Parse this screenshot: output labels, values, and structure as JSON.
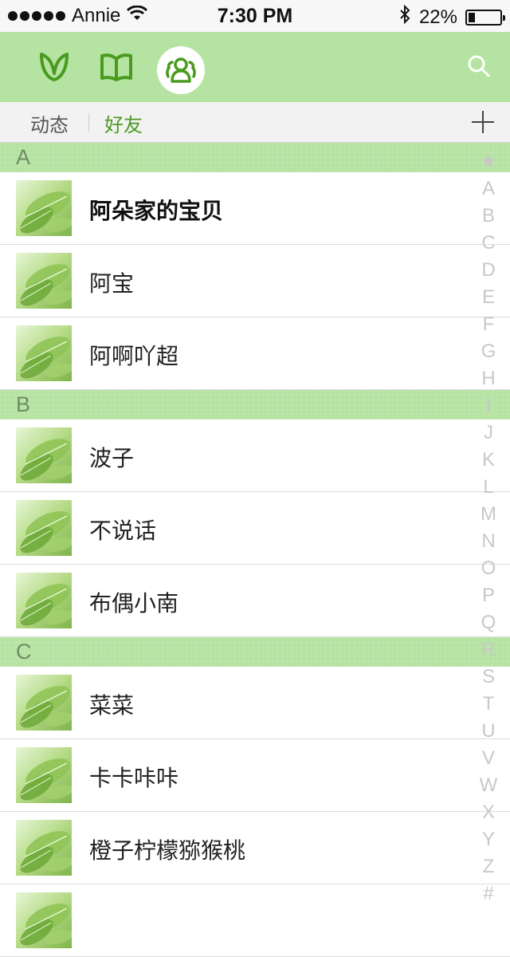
{
  "status_bar": {
    "carrier": "Annie",
    "time": "7:30 PM",
    "battery_text": "22%",
    "battery_level": 0.22
  },
  "top_nav": {
    "icons": [
      "leaf-icon",
      "book-icon",
      "friends-icon",
      "search-icon"
    ],
    "active": "friends-icon",
    "accent_color": "#4a9a1f",
    "bar_color": "#b5e3a2"
  },
  "tabs": {
    "items": [
      "动态",
      "好友"
    ],
    "active": "好友",
    "add_icon": "plus-icon"
  },
  "sections": [
    {
      "letter": "A",
      "contacts": [
        {
          "name": "阿朵家的宝贝"
        },
        {
          "name": "阿宝"
        },
        {
          "name": "阿啊吖超"
        }
      ]
    },
    {
      "letter": "B",
      "contacts": [
        {
          "name": "波子"
        },
        {
          "name": "不说话"
        },
        {
          "name": "布偶小南"
        }
      ]
    },
    {
      "letter": "C",
      "contacts": [
        {
          "name": "菜菜"
        },
        {
          "name": "卡卡咔咔"
        },
        {
          "name": "橙子柠檬猕猴桃"
        },
        {
          "name": ""
        }
      ]
    }
  ],
  "index_bar": [
    "★",
    "A",
    "B",
    "C",
    "D",
    "E",
    "F",
    "G",
    "H",
    "I",
    "J",
    "K",
    "L",
    "M",
    "N",
    "O",
    "P",
    "Q",
    "R",
    "S",
    "T",
    "U",
    "V",
    "W",
    "X",
    "Y",
    "Z",
    "#"
  ]
}
